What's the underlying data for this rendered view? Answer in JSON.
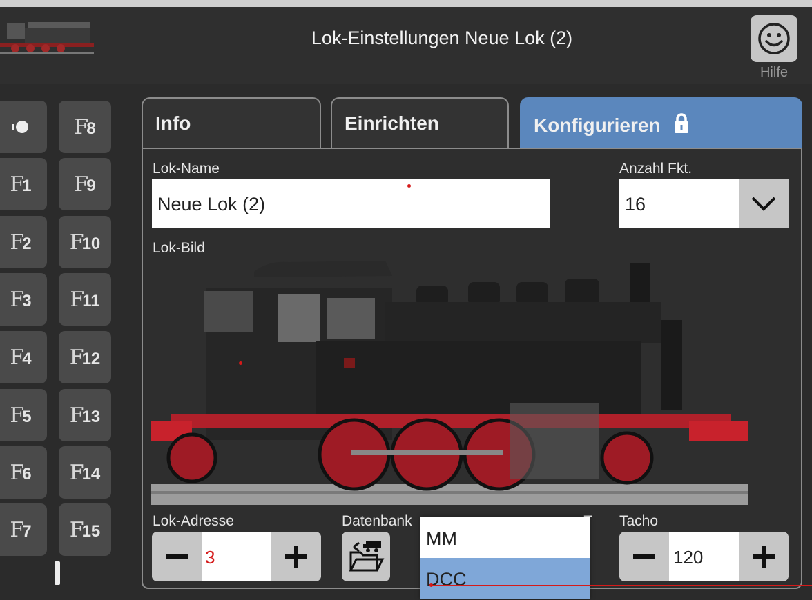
{
  "header": {
    "title": "Lok-Einstellungen Neue Lok (2)",
    "help_label": "Hilfe"
  },
  "functions": {
    "col1": [
      {
        "f": "",
        "n": "",
        "icon": "headlight-icon"
      },
      {
        "f": "F",
        "n": "1"
      },
      {
        "f": "F",
        "n": "2"
      },
      {
        "f": "F",
        "n": "3"
      },
      {
        "f": "F",
        "n": "4"
      },
      {
        "f": "F",
        "n": "5"
      },
      {
        "f": "F",
        "n": "6"
      },
      {
        "f": "F",
        "n": "7"
      }
    ],
    "col2": [
      {
        "f": "F",
        "n": "8"
      },
      {
        "f": "F",
        "n": "9"
      },
      {
        "f": "F",
        "n": "10"
      },
      {
        "f": "F",
        "n": "11"
      },
      {
        "f": "F",
        "n": "12"
      },
      {
        "f": "F",
        "n": "13"
      },
      {
        "f": "F",
        "n": "14"
      },
      {
        "f": "F",
        "n": "15"
      }
    ]
  },
  "tabs": [
    {
      "label": "Info",
      "active": false
    },
    {
      "label": "Einrichten",
      "active": false
    },
    {
      "label": "Konfigurieren",
      "active": true,
      "icon": "lock-icon"
    }
  ],
  "form": {
    "name_label": "Lok-Name",
    "name_value": "Neue Lok (2)",
    "count_label": "Anzahl Fkt.",
    "count_value": "16",
    "image_label": "Lok-Bild",
    "address_label": "Lok-Adresse",
    "address_value": "3",
    "db_label": "Datenbank ",
    "db_label_tail": "T",
    "tacho_label": "Tacho",
    "tacho_value": "120"
  },
  "protocol_dropdown": {
    "options": [
      "MM",
      "DCC"
    ],
    "selected": "DCC"
  },
  "colors": {
    "accent_blue": "#5b87bd",
    "selected_option": "#7fa7d8",
    "address_value": "#d51a1a",
    "callout_line": "#d51a1a"
  }
}
